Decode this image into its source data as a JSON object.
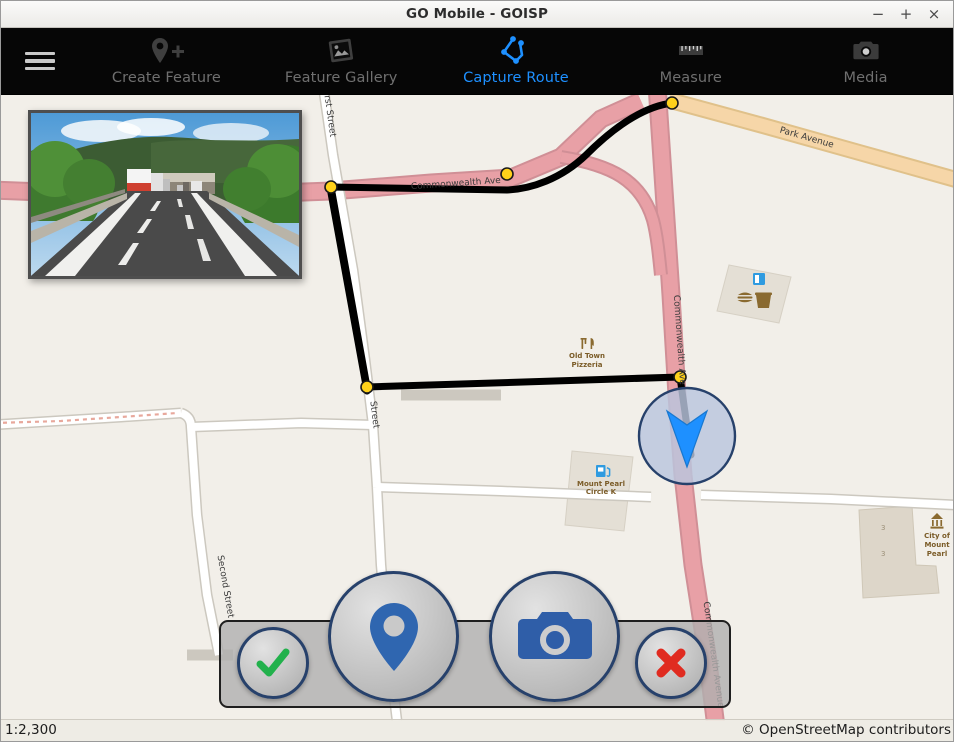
{
  "window": {
    "title": "GO Mobile - GOISP",
    "controls": [
      {
        "name": "minimize",
        "glyph": "−"
      },
      {
        "name": "maximize",
        "glyph": "+"
      },
      {
        "name": "close",
        "glyph": "×"
      }
    ]
  },
  "toolbar": {
    "menu_label": "Menu",
    "accent_color": "#1e90ff",
    "inactive_color": "#6f6f6f",
    "background": "#060606",
    "items": [
      {
        "label": "Create Feature",
        "icon": "map-pin-plus-icon",
        "active": false
      },
      {
        "label": "Feature Gallery",
        "icon": "photo-gallery-icon",
        "active": false
      },
      {
        "label": "Capture Route",
        "icon": "polyline-route-icon",
        "active": true
      },
      {
        "label": "Measure",
        "icon": "ruler-icon",
        "active": false
      },
      {
        "label": "Media",
        "icon": "camera-icon",
        "active": false
      }
    ]
  },
  "photo_preview": {
    "name": "captured-photo-thumbnail",
    "description": "Highway with truck and overpass"
  },
  "map": {
    "background_color": "#f2efe9",
    "primary_road_color": "#e8a0a6",
    "secondary_road_color": "#f6d6a8",
    "minor_road_color": "#ffffff",
    "route_color": "#000000",
    "vertex_color": "#ffd11a",
    "gps_marker_color": "#1e90ff",
    "roads": [
      {
        "name": "Park Avenue",
        "type": "secondary"
      },
      {
        "name": "Commonwealth Ave",
        "type": "primary"
      },
      {
        "name": "Commonwealth Avenue",
        "type": "primary"
      },
      {
        "name": "Second Street",
        "type": "minor"
      },
      {
        "name": "Street",
        "type": "minor"
      },
      {
        "name": "First Street",
        "type": "minor"
      }
    ],
    "pois": [
      {
        "name": "Old Town Pizzeria",
        "icon": "restaurant-icon"
      },
      {
        "name": "Mount Pearl Circle K",
        "icon": "fuel-icon"
      },
      {
        "name": "City of Mount Pearl",
        "icon": "townhall-icon"
      }
    ],
    "house_numbers": [
      "3",
      "3"
    ],
    "route_vertices": 5
  },
  "controls": {
    "accept": {
      "label": "Accept",
      "icon": "check-icon",
      "color": "#22b14c"
    },
    "add_point": {
      "label": "Add Point",
      "icon": "map-pin-icon",
      "color": "#2f66b0"
    },
    "take_photo": {
      "label": "Take Photo",
      "icon": "camera-icon",
      "color": "#2f5ea8"
    },
    "cancel": {
      "label": "Cancel",
      "icon": "close-x-icon",
      "color": "#e02b20"
    }
  },
  "status": {
    "scale": "1:2,300",
    "attribution": "© OpenStreetMap contributors"
  }
}
